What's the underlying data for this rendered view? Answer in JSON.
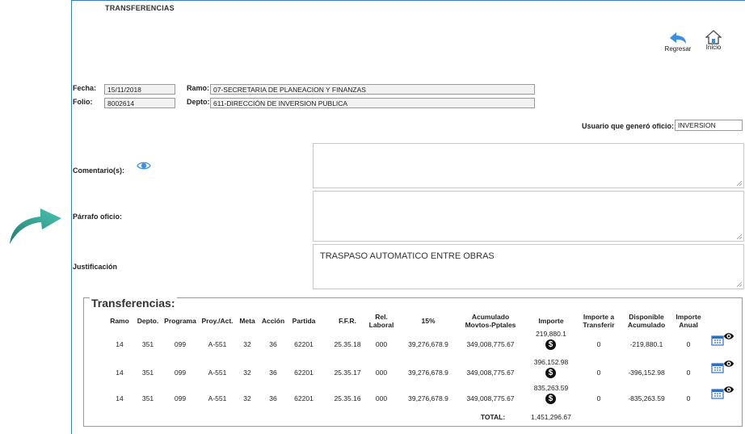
{
  "header": {
    "title": "TRANSFERENCIAS",
    "back_label": "Regresar",
    "home_label": "Inicio"
  },
  "form": {
    "fecha_label": "Fecha:",
    "fecha_value": "15/11/2018",
    "folio_label": "Folio:",
    "folio_value": "8002614",
    "ramo_label": "Ramo:",
    "ramo_value": "07-SECRETARIA DE PLANEACION Y FINANZAS",
    "depto_label": "Depto:",
    "depto_value": "611-DIRECCIÓN DE INVERSION PUBLICA",
    "usuario_label": "Usuario que generó oficio:",
    "usuario_value": "INVERSION",
    "comentarios_label": "Comentario(s):",
    "parrafo_label": "Párrafo oficio:",
    "justificacion_label": "Justificación",
    "justificacion_value": "TRASPASO AUTOMATICO ENTRE OBRAS"
  },
  "transfers": {
    "legend": "Transferencias:",
    "headers": [
      "Ramo",
      "Depto.",
      "Programa",
      "Proy./Act.",
      "Meta",
      "Acción",
      "Partida",
      "F.F.R.",
      "Rel. Laboral",
      "15%",
      "Acumulado Movtos-Pptales",
      "Importe",
      "Importe a Transferir",
      "Disponible Acumulado",
      "Importe Anual"
    ],
    "rows": [
      [
        "14",
        "351",
        "099",
        "A-551",
        "32",
        "36",
        "62201",
        "25.35.18",
        "000",
        "39,276,678.9",
        "349,008,775.67",
        "219,880.1",
        "0",
        "-219,880.1",
        "0"
      ],
      [
        "14",
        "351",
        "099",
        "A-551",
        "32",
        "36",
        "62201",
        "25.35.17",
        "000",
        "39,276,678.9",
        "349,008,775.67",
        "396,152.98",
        "0",
        "-396,152.98",
        "0"
      ],
      [
        "14",
        "351",
        "099",
        "A-551",
        "32",
        "36",
        "62201",
        "25.35.16",
        "000",
        "39,276,678.9",
        "349,008,775.67",
        "835,263.59",
        "0",
        "-835,263.59",
        "0"
      ]
    ],
    "total_label": "TOTAL:",
    "total_value": "1,451,296.67"
  },
  "colors": {
    "frame_border": "#3a7cc4",
    "arrow": "#2a9d8f",
    "eye_icon": "#3a8ee6",
    "calendar_icon": "#2f6fc0"
  }
}
